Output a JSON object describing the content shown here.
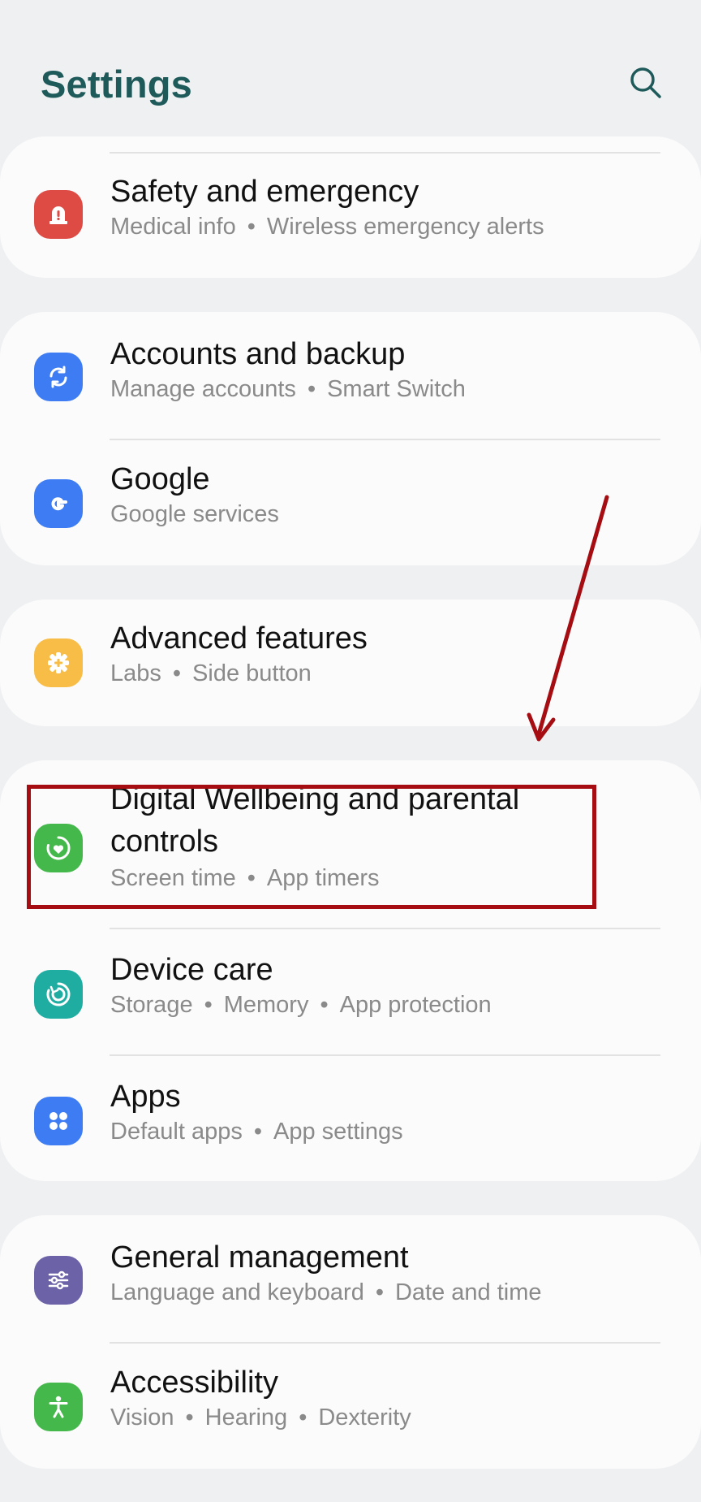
{
  "header": {
    "title": "Settings",
    "search_icon": "search-icon"
  },
  "items": [
    {
      "id": "safety",
      "title": "Safety and emergency",
      "sub": [
        "Medical info",
        "Wireless emergency alerts"
      ],
      "icon": "siren-icon",
      "color": "#de4b45"
    },
    {
      "id": "accounts",
      "title": "Accounts and backup",
      "sub": [
        "Manage accounts",
        "Smart Switch"
      ],
      "icon": "sync-icon",
      "color": "#3d7cf2"
    },
    {
      "id": "google",
      "title": "Google",
      "sub": [
        "Google services"
      ],
      "icon": "google-g-icon",
      "color": "#3d7cf2"
    },
    {
      "id": "advanced",
      "title": "Advanced features",
      "sub": [
        "Labs",
        "Side button"
      ],
      "icon": "gear-plus-icon",
      "color": "#f7bd46"
    },
    {
      "id": "wellbeing",
      "title_line1": "Digital Wellbeing and parental",
      "title_line2": "controls",
      "sub": [
        "Screen time",
        "App timers"
      ],
      "icon": "wellbeing-heart-icon",
      "color": "#45b84b"
    },
    {
      "id": "devicecare",
      "title": "Device care",
      "sub": [
        "Storage",
        "Memory",
        "App protection"
      ],
      "icon": "device-care-icon",
      "color": "#1fada2"
    },
    {
      "id": "apps",
      "title": "Apps",
      "sub": [
        "Default apps",
        "App settings"
      ],
      "icon": "apps-grid-icon",
      "color": "#3d7cf2"
    },
    {
      "id": "general",
      "title": "General management",
      "sub": [
        "Language and keyboard",
        "Date and time"
      ],
      "icon": "sliders-icon",
      "color": "#6b62a8"
    },
    {
      "id": "accessibility",
      "title": "Accessibility",
      "sub": [
        "Vision",
        "Hearing",
        "Dexterity"
      ],
      "icon": "accessibility-person-icon",
      "color": "#45b84b"
    }
  ],
  "annotation": {
    "highlight_color": "#a50d12"
  }
}
